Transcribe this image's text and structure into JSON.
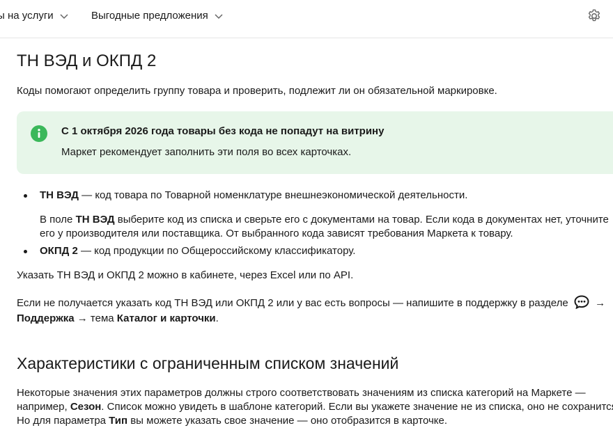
{
  "header": {
    "nav_1": "ы на услуги",
    "nav_2": "Выгодные предложения",
    "settings_icon": "gear-icon"
  },
  "section_1": {
    "title": "ТН ВЭД и ОКПД 2",
    "intro": "Коды помогают определить группу товара и проверить, подлежит ли он обязательной маркировке.",
    "notice": {
      "title": "С 1 октября 2026 года товары без кода не попадут на витрину",
      "body": "Маркет рекомендует заполнить эти поля во всех карточках.",
      "icon": "info-icon",
      "color": "#e7f6e9"
    },
    "bullets": [
      {
        "term": "ТН ВЭД",
        "desc": " — код товара по Товарной номенклатуре внешнеэкономической деятельности.",
        "sub_pre": "В поле ",
        "sub_term": "ТН ВЭД",
        "sub_line1": " выберите код из списка и сверьте его с документами на товар. Если кода в документах нет, уточните",
        "sub_line2": "его у производителя или поставщика. От выбранного кода зависят требования Маркета к товару."
      },
      {
        "term": "ОКПД 2",
        "desc": " — код продукции по Общероссийскому классификатору."
      }
    ],
    "how_to": "Указать ТН ВЭД и ОКПД 2 можно в кабинете, через Excel или по API.",
    "support_line1": "Если не получается указать код ТН ВЭД или ОКПД 2 или у вас есть вопросы — напишите в поддержку в разделе",
    "support_arrow": "→",
    "support_link": "Поддержка",
    "support_mid": " → тема ",
    "support_topic": "Каталог и карточки",
    "support_end": "."
  },
  "section_2": {
    "title": "Характеристики с ограниченным списком значений",
    "line1": "Некоторые значения этих параметров должны строго соответствовать значениям из списка категорий на Маркете —",
    "line2_pre": "например, ",
    "line2_term": "Сезон",
    "line2_post": ". Список можно увидеть в шаблоне категорий. Если вы укажете значение не из списка, оно не сохранится.",
    "line3_pre": "Но для параметра ",
    "line3_term": "Тип",
    "line3_post": " вы можете указать свое значение — оно отобразится в карточке."
  }
}
